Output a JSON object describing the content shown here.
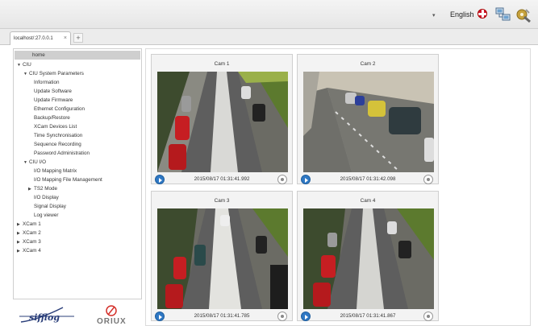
{
  "header": {
    "language": "English",
    "language_caret": "▾"
  },
  "browser": {
    "tab_label": "localhost/:27.0.0.1",
    "tab_close": "×",
    "tab_add": "+"
  },
  "sidebar": {
    "items": [
      {
        "label": "home",
        "toggle": ""
      },
      {
        "label": "CIU",
        "toggle": "▼"
      },
      {
        "label": "CIU System Parameters",
        "toggle": "▼"
      },
      {
        "label": "Information",
        "toggle": ""
      },
      {
        "label": "Update Software",
        "toggle": ""
      },
      {
        "label": "Update Firmware",
        "toggle": ""
      },
      {
        "label": "Ethernet Configuration",
        "toggle": ""
      },
      {
        "label": "Backup/Restore",
        "toggle": ""
      },
      {
        "label": "XCam Devices List",
        "toggle": ""
      },
      {
        "label": "Time Synchronisation",
        "toggle": ""
      },
      {
        "label": "Sequence Recording",
        "toggle": ""
      },
      {
        "label": "Password Administration",
        "toggle": ""
      },
      {
        "label": "CIU I/O",
        "toggle": "▼"
      },
      {
        "label": "I/O Mapping Matrix",
        "toggle": ""
      },
      {
        "label": "I/O Mapping File Management",
        "toggle": ""
      },
      {
        "label": "TS2 Mode",
        "toggle": "▶"
      },
      {
        "label": "I/O Display",
        "toggle": ""
      },
      {
        "label": "Signal Display",
        "toggle": ""
      },
      {
        "label": "Log viewer",
        "toggle": ""
      },
      {
        "label": "XCam 1",
        "toggle": "▶"
      },
      {
        "label": "XCam 2",
        "toggle": "▶"
      },
      {
        "label": "XCam 3",
        "toggle": "▶"
      },
      {
        "label": "XCam 4",
        "toggle": "▶"
      }
    ]
  },
  "cameras": [
    {
      "title": "Cam 1",
      "timestamp": "2015/08/17 01:31:41.992"
    },
    {
      "title": "Cam 2",
      "timestamp": "2015/08/17 01:31:42.098"
    },
    {
      "title": "Cam 3",
      "timestamp": "2015/08/17 01:31:41.785"
    },
    {
      "title": "Cam 4",
      "timestamp": "2015/08/17 01:31:41.867"
    }
  ],
  "logos": {
    "primary": "sifflog",
    "secondary": "ORIUX"
  },
  "colors": {
    "accent_blue": "#2f78c4",
    "selected_item": "#cfcfcf",
    "flag_red": "#cf142b"
  }
}
